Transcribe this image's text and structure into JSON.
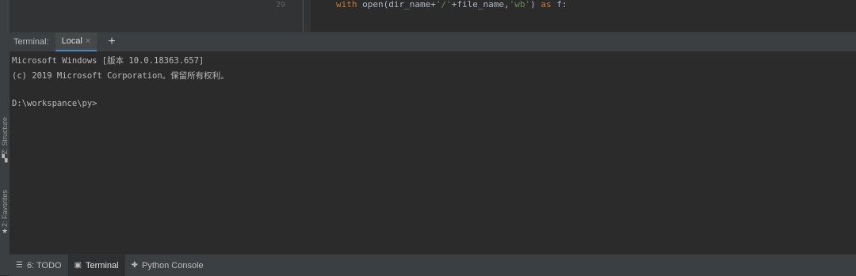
{
  "editor": {
    "line_number": "29",
    "code_with": "with",
    "code_open": " open(dir_name+",
    "code_str1": "'/'",
    "code_mid": "+file_name,",
    "code_str2": "'wb'",
    "code_close": ") ",
    "code_as": "as",
    "code_end": " f:"
  },
  "left_tools": {
    "structure": "Z: Structure",
    "favorites": "2: Favorites"
  },
  "terminal": {
    "label": "Terminal:",
    "tab_local": "Local",
    "tab_close": "×",
    "add": "+",
    "lines": [
      "Microsoft Windows [版本 10.0.18363.657]",
      "(c) 2019 Microsoft Corporation。保留所有权利。",
      "",
      "D:\\workspance\\py>"
    ]
  },
  "bottom_bar": {
    "todo": "6: TODO",
    "terminal": "Terminal",
    "python_console": "Python Console"
  },
  "colors": {
    "background": "#2b2b2b",
    "panel": "#3c3f41",
    "accent": "#4a88c7",
    "keyword": "#cc7832",
    "string": "#6a8759"
  }
}
